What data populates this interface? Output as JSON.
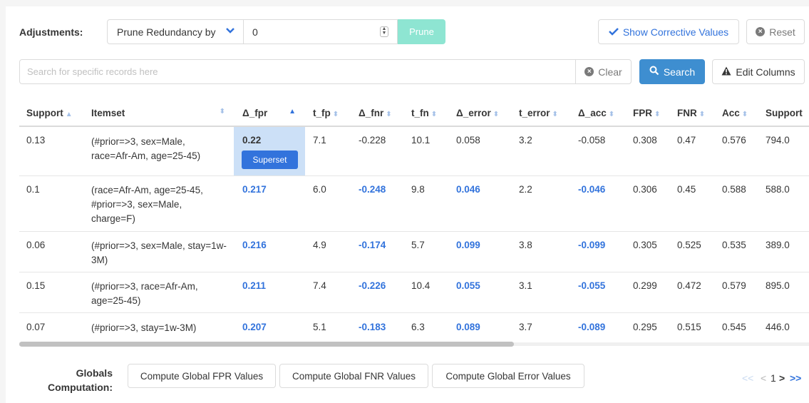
{
  "adjustments": {
    "label": "Adjustments:",
    "select_value": "Prune Redundancy by",
    "number_value": "0",
    "prune_label": "Prune",
    "show_corrective_label": "Show Corrective Values",
    "reset_label": "Reset"
  },
  "search": {
    "placeholder": "Search for specific records here",
    "clear_label": "Clear",
    "search_label": "Search",
    "edit_columns_label": "Edit Columns"
  },
  "table": {
    "headers": [
      "Support",
      "Itemset",
      "Δ_fpr",
      "t_fp",
      "Δ_fnr",
      "t_fn",
      "Δ_error",
      "t_error",
      "Δ_acc",
      "FPR",
      "FNR",
      "Acc",
      "Support"
    ],
    "rows": [
      {
        "support": "0.13",
        "itemset": "(#prior=>3, sex=Male, race=Afr-Am, age=25-45)",
        "d_fpr": "0.22",
        "t_fp": "7.1",
        "d_fnr": "-0.228",
        "t_fn": "10.1",
        "d_error": "0.058",
        "t_error": "3.2",
        "d_acc": "-0.058",
        "fpr": "0.308",
        "fnr": "0.47",
        "acc": "0.576",
        "support_count": "794.0",
        "badge": "Superset"
      },
      {
        "support": "0.1",
        "itemset": "(race=Afr-Am, age=25-45, #prior=>3, sex=Male, charge=F)",
        "d_fpr": "0.217",
        "t_fp": "6.0",
        "d_fnr": "-0.248",
        "t_fn": "9.8",
        "d_error": "0.046",
        "t_error": "2.2",
        "d_acc": "-0.046",
        "fpr": "0.306",
        "fnr": "0.45",
        "acc": "0.588",
        "support_count": "588.0"
      },
      {
        "support": "0.06",
        "itemset": "(#prior=>3, sex=Male, stay=1w-3M)",
        "d_fpr": "0.216",
        "t_fp": "4.9",
        "d_fnr": "-0.174",
        "t_fn": "5.7",
        "d_error": "0.099",
        "t_error": "3.8",
        "d_acc": "-0.099",
        "fpr": "0.305",
        "fnr": "0.525",
        "acc": "0.535",
        "support_count": "389.0"
      },
      {
        "support": "0.15",
        "itemset": "(#prior=>3, race=Afr-Am, age=25-45)",
        "d_fpr": "0.211",
        "t_fp": "7.4",
        "d_fnr": "-0.226",
        "t_fn": "10.4",
        "d_error": "0.055",
        "t_error": "3.1",
        "d_acc": "-0.055",
        "fpr": "0.299",
        "fnr": "0.472",
        "acc": "0.579",
        "support_count": "895.0"
      },
      {
        "support": "0.07",
        "itemset": "(#prior=>3, stay=1w-3M)",
        "d_fpr": "0.207",
        "t_fp": "5.1",
        "d_fnr": "-0.183",
        "t_fn": "6.3",
        "d_error": "0.089",
        "t_error": "3.7",
        "d_acc": "-0.089",
        "fpr": "0.295",
        "fnr": "0.515",
        "acc": "0.545",
        "support_count": "446.0"
      }
    ]
  },
  "globals": {
    "label": "Globals Computation:",
    "fpr_button": "Compute Global FPR Values",
    "fnr_button": "Compute Global FNR Values",
    "error_button": "Compute Global Error Values"
  },
  "pagination": {
    "first": "<<",
    "prev": "<",
    "page": "1",
    "next": ">",
    "last": ">>"
  },
  "colors": {
    "accent": "#3273dc",
    "prune_button": "#8ee5d2",
    "search_button": "#3e8ed0",
    "highlight_cell": "#cce0f7"
  }
}
